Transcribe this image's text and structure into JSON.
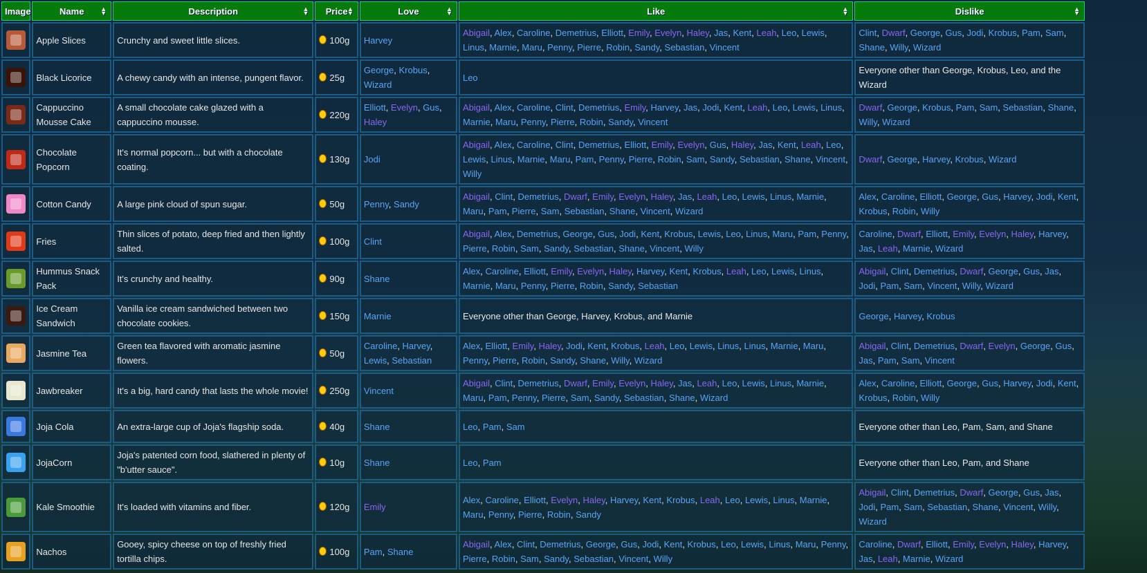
{
  "headers": {
    "image": "Image",
    "name": "Name",
    "description": "Description",
    "price": "Price",
    "love": "Love",
    "like": "Like",
    "dislike": "Dislike"
  },
  "rows": [
    {
      "name": "Apple Slices",
      "description": "Crunchy and sweet little slices.",
      "price": "100g",
      "icon_color": "#b65a3a",
      "love": [
        "Harvey"
      ],
      "like": [
        "Abigail",
        "Alex",
        "Caroline",
        "Demetrius",
        "Elliott",
        "Emily",
        "Evelyn",
        "Haley",
        "Jas",
        "Kent",
        "Leah",
        "Leo",
        "Lewis",
        "Linus",
        "Marnie",
        "Maru",
        "Penny",
        "Pierre",
        "Robin",
        "Sandy",
        "Sebastian",
        "Vincent"
      ],
      "dislike": [
        "Clint",
        "Dwarf",
        "George",
        "Gus",
        "Jodi",
        "Krobus",
        "Pam",
        "Sam",
        "Shane",
        "Willy",
        "Wizard"
      ]
    },
    {
      "name": "Black Licorice",
      "description": "A chewy candy with an intense, pungent flavor.",
      "price": "25g",
      "icon_color": "#3a1208",
      "love": [
        "George",
        "Krobus",
        "Wizard"
      ],
      "like": [
        "Leo"
      ],
      "dislike_text": "Everyone other than George, Krobus, Leo, and the Wizard"
    },
    {
      "name": "Cappuccino Mousse Cake",
      "description": "A small chocolate cake glazed with a cappuccino mousse.",
      "price": "220g",
      "icon_color": "#7a2a18",
      "love": [
        "Elliott",
        "Evelyn",
        "Gus",
        "Haley"
      ],
      "like": [
        "Abigail",
        "Alex",
        "Caroline",
        "Clint",
        "Demetrius",
        "Emily",
        "Harvey",
        "Jas",
        "Jodi",
        "Kent",
        "Leah",
        "Leo",
        "Lewis",
        "Linus",
        "Marnie",
        "Maru",
        "Penny",
        "Pierre",
        "Robin",
        "Sandy",
        "Vincent"
      ],
      "dislike": [
        "Dwarf",
        "George",
        "Krobus",
        "Pam",
        "Sam",
        "Sebastian",
        "Shane",
        "Willy",
        "Wizard"
      ]
    },
    {
      "name": "Chocolate Popcorn",
      "description": "It's normal popcorn... but with a chocolate coating.",
      "price": "130g",
      "icon_color": "#c02818",
      "love": [
        "Jodi"
      ],
      "like": [
        "Abigail",
        "Alex",
        "Caroline",
        "Clint",
        "Demetrius",
        "Elliott",
        "Emily",
        "Evelyn",
        "Gus",
        "Haley",
        "Jas",
        "Kent",
        "Leah",
        "Leo",
        "Lewis",
        "Linus",
        "Marnie",
        "Maru",
        "Pam",
        "Penny",
        "Pierre",
        "Robin",
        "Sam",
        "Sandy",
        "Sebastian",
        "Shane",
        "Vincent",
        "Willy"
      ],
      "dislike": [
        "Dwarf",
        "George",
        "Harvey",
        "Krobus",
        "Wizard"
      ]
    },
    {
      "name": "Cotton Candy",
      "description": "A large pink cloud of spun sugar.",
      "price": "50g",
      "icon_color": "#f088c8",
      "love": [
        "Penny",
        "Sandy"
      ],
      "like": [
        "Abigail",
        "Clint",
        "Demetrius",
        "Dwarf",
        "Emily",
        "Evelyn",
        "Haley",
        "Jas",
        "Leah",
        "Leo",
        "Lewis",
        "Linus",
        "Marnie",
        "Maru",
        "Pam",
        "Pierre",
        "Sam",
        "Sebastian",
        "Shane",
        "Vincent",
        "Wizard"
      ],
      "dislike": [
        "Alex",
        "Caroline",
        "Elliott",
        "George",
        "Gus",
        "Harvey",
        "Jodi",
        "Kent",
        "Krobus",
        "Robin",
        "Willy"
      ]
    },
    {
      "name": "Fries",
      "description": "Thin slices of potato, deep fried and then lightly salted.",
      "price": "100g",
      "icon_color": "#e03a18",
      "love": [
        "Clint"
      ],
      "like": [
        "Abigail",
        "Alex",
        "Demetrius",
        "George",
        "Gus",
        "Jodi",
        "Kent",
        "Krobus",
        "Lewis",
        "Leo",
        "Linus",
        "Maru",
        "Pam",
        "Penny",
        "Pierre",
        "Robin",
        "Sam",
        "Sandy",
        "Sebastian",
        "Shane",
        "Vincent",
        "Willy"
      ],
      "dislike": [
        "Caroline",
        "Dwarf",
        "Elliott",
        "Emily",
        "Evelyn",
        "Haley",
        "Harvey",
        "Jas",
        "Leah",
        "Marnie",
        "Wizard"
      ]
    },
    {
      "name": "Hummus Snack Pack",
      "description": "It's crunchy and healthy.",
      "price": "90g",
      "icon_color": "#6a9a2a",
      "love": [
        "Shane"
      ],
      "like": [
        "Alex",
        "Caroline",
        "Elliott",
        "Emily",
        "Evelyn",
        "Haley",
        "Harvey",
        "Kent",
        "Krobus",
        "Leah",
        "Leo",
        "Lewis",
        "Linus",
        "Marnie",
        "Maru",
        "Penny",
        "Pierre",
        "Robin",
        "Sandy",
        "Sebastian"
      ],
      "dislike": [
        "Abigail",
        "Clint",
        "Demetrius",
        "Dwarf",
        "George",
        "Gus",
        "Jas",
        "Jodi",
        "Pam",
        "Sam",
        "Vincent",
        "Willy",
        "Wizard"
      ]
    },
    {
      "name": "Ice Cream Sandwich",
      "description": "Vanilla ice cream sandwiched between two chocolate cookies.",
      "price": "150g",
      "icon_color": "#3a1a10",
      "love": [
        "Marnie"
      ],
      "like_text": "Everyone other than George, Harvey, Krobus, and Marnie",
      "dislike": [
        "George",
        "Harvey",
        "Krobus"
      ]
    },
    {
      "name": "Jasmine Tea",
      "description": "Green tea flavored with aromatic jasmine flowers.",
      "price": "50g",
      "icon_color": "#e8a860",
      "love": [
        "Caroline",
        "Harvey",
        "Lewis",
        "Sebastian"
      ],
      "like": [
        "Alex",
        "Elliott",
        "Emily",
        "Haley",
        "Jodi",
        "Kent",
        "Krobus",
        "Leah",
        "Leo",
        "Lewis",
        "Linus",
        "Linus",
        "Marnie",
        "Maru",
        "Penny",
        "Pierre",
        "Robin",
        "Sandy",
        "Shane",
        "Willy",
        "Wizard"
      ],
      "dislike": [
        "Abigail",
        "Clint",
        "Demetrius",
        "Dwarf",
        "Evelyn",
        "George",
        "Gus",
        "Jas",
        "Pam",
        "Sam",
        "Vincent"
      ]
    },
    {
      "name": "Jawbreaker",
      "description": "It's a big, hard candy that lasts the whole movie!",
      "price": "250g",
      "icon_color": "#e8e8d0",
      "love": [
        "Vincent"
      ],
      "like": [
        "Abigail",
        "Clint",
        "Demetrius",
        "Dwarf",
        "Emily",
        "Evelyn",
        "Haley",
        "Jas",
        "Leah",
        "Leo",
        "Lewis",
        "Linus",
        "Marnie",
        "Maru",
        "Pam",
        "Penny",
        "Pierre",
        "Sam",
        "Sandy",
        "Sebastian",
        "Shane",
        "Wizard"
      ],
      "dislike": [
        "Alex",
        "Caroline",
        "Elliott",
        "George",
        "Gus",
        "Harvey",
        "Jodi",
        "Kent",
        "Krobus",
        "Robin",
        "Willy"
      ]
    },
    {
      "name": "Joja Cola",
      "description": "An extra-large cup of Joja's flagship soda.",
      "price": "40g",
      "icon_color": "#3a7ae0",
      "love": [
        "Shane"
      ],
      "like": [
        "Leo",
        "Pam",
        "Sam"
      ],
      "dislike_text": "Everyone other than Leo, Pam, Sam, and Shane"
    },
    {
      "name": "JojaCorn",
      "description": "Joja's patented corn food, slathered in plenty of \"b'utter sauce\".",
      "price": "10g",
      "icon_color": "#3aa0f0",
      "love": [
        "Shane"
      ],
      "like": [
        "Leo",
        "Pam"
      ],
      "dislike_text": "Everyone other than Leo, Pam, and Shane"
    },
    {
      "name": "Kale Smoothie",
      "description": "It's loaded with vitamins and fiber.",
      "price": "120g",
      "icon_color": "#4a9a3a",
      "love": [
        "Emily"
      ],
      "like": [
        "Alex",
        "Caroline",
        "Elliott",
        "Evelyn",
        "Haley",
        "Harvey",
        "Kent",
        "Krobus",
        "Leah",
        "Leo",
        "Lewis",
        "Linus",
        "Marnie",
        "Maru",
        "Penny",
        "Pierre",
        "Robin",
        "Sandy"
      ],
      "dislike": [
        "Abigail",
        "Clint",
        "Demetrius",
        "Dwarf",
        "George",
        "Gus",
        "Jas",
        "Jodi",
        "Pam",
        "Sam",
        "Sebastian",
        "Shane",
        "Vincent",
        "Willy",
        "Wizard"
      ]
    },
    {
      "name": "Nachos",
      "description": "Gooey, spicy cheese on top of freshly fried tortilla chips.",
      "price": "100g",
      "icon_color": "#e8a020",
      "love": [
        "Pam",
        "Shane"
      ],
      "like": [
        "Abigail",
        "Alex",
        "Clint",
        "Demetrius",
        "George",
        "Gus",
        "Jodi",
        "Kent",
        "Krobus",
        "Leo",
        "Lewis",
        "Linus",
        "Maru",
        "Penny",
        "Pierre",
        "Robin",
        "Sam",
        "Sandy",
        "Sebastian",
        "Vincent",
        "Willy"
      ],
      "dislike": [
        "Caroline",
        "Dwarf",
        "Elliott",
        "Emily",
        "Evelyn",
        "Haley",
        "Harvey",
        "Jas",
        "Leah",
        "Marnie",
        "Wizard"
      ]
    }
  ]
}
